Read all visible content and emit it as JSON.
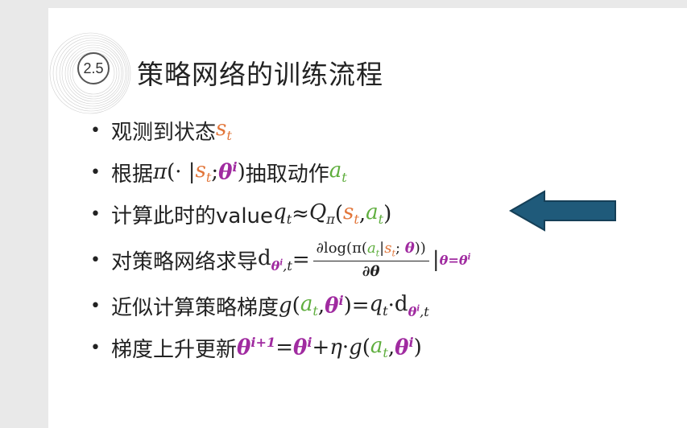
{
  "slide": {
    "section_number": "2.5",
    "title": "策略网络的训练流程",
    "accent_colors": {
      "orange": "#e2763a",
      "green": "#5fae3e",
      "purple": "#a02ba0",
      "arrow": "#1f5a7a"
    }
  },
  "bullets": {
    "b1": {
      "text": "观测到状态",
      "var": "s",
      "sub": "t"
    },
    "b2": {
      "text_a": "根据",
      "pi": "π",
      "open": "(· |",
      "s": "s",
      "s_sub": "t",
      "sep": "; ",
      "theta": "θ",
      "theta_sup": "i",
      "close": ")",
      "text_b": "抽取动作",
      "a": "a",
      "a_sub": "t"
    },
    "b3": {
      "text": "计算此时的value ",
      "q": "q",
      "q_sub": "t",
      "approx": " ≈ ",
      "Q": "Q",
      "Q_sub": "π",
      "open": "(",
      "s": "s",
      "s_sub": "t",
      "comma": ", ",
      "a": "a",
      "a_sub": "t",
      "close": ")"
    },
    "b4": {
      "text": "对策略网络求导",
      "d": "d",
      "d_sub_theta": "θ",
      "d_sub_sup": "i",
      "d_sub_t": ",t",
      "eq": " = ",
      "num": "∂log(π(",
      "a": "a",
      "a_sub": "t",
      "bar": "|",
      "s": "s",
      "s_sub": "t",
      "sep": "; ",
      "theta": "θ",
      "num_close": "))",
      "den": "∂θ",
      "eval_bar": "|",
      "eval": "θ=θ",
      "eval_sup": "i"
    },
    "b5": {
      "text": "近似计算策略梯度",
      "g": "g",
      "open": "(",
      "a": "a",
      "a_sub": "t",
      "comma": ", ",
      "theta": "θ",
      "theta_sup": "i",
      "close": ")",
      "eq": " = ",
      "q": "q",
      "q_sub": "t",
      "dot": " · ",
      "d": "d",
      "d_sub_theta": "θ",
      "d_sub_sup": "i",
      "d_sub_t": ",t"
    },
    "b6": {
      "text": "梯度上升更新",
      "theta": "θ",
      "sup_next": "i+1",
      "eq": " = ",
      "theta2": "θ",
      "sup2": "i",
      "plus": " + ",
      "eta": "η",
      "dot": " · ",
      "g": "g",
      "open": "(",
      "a": "a",
      "a_sub": "t",
      "comma": ", ",
      "theta3": "θ",
      "sup3": "i",
      "close": ")"
    }
  },
  "bullet_char": "•",
  "arrow_icon": "left-arrow-icon"
}
